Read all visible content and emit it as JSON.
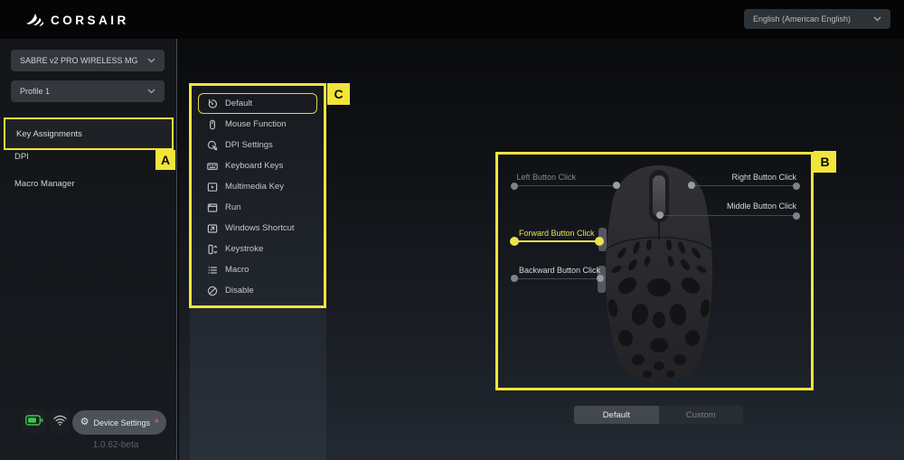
{
  "header": {
    "brand": "CORSAIR",
    "language_selector": {
      "value": "English (American English)"
    }
  },
  "sidebar": {
    "device_selector": {
      "value": "SABRE v2 PRO WIRELESS MG"
    },
    "profile_selector": {
      "value": "Profile 1"
    },
    "nav": [
      {
        "label": "Key Assignments",
        "active": true
      },
      {
        "label": "DPI",
        "active": false
      },
      {
        "label": "Macro Manager",
        "active": false
      }
    ],
    "status_bar": {
      "battery_icon": "battery-full-green",
      "wireless_icon": "wifi-signal",
      "device_settings_label": "Device Settings",
      "alert_glyph": "*",
      "version": "1.0.62-beta"
    }
  },
  "assignment_menu": {
    "items": [
      {
        "label": "Default",
        "icon": "reset-icon",
        "selected": true
      },
      {
        "label": "Mouse Function",
        "icon": "mouse-icon",
        "selected": false
      },
      {
        "label": "DPI Settings",
        "icon": "dpi-gauge-icon",
        "selected": false
      },
      {
        "label": "Keyboard Keys",
        "icon": "keyboard-icon",
        "selected": false
      },
      {
        "label": "Multimedia Key",
        "icon": "media-play-icon",
        "selected": false
      },
      {
        "label": "Run",
        "icon": "app-window-icon",
        "selected": false
      },
      {
        "label": "Windows Shortcut",
        "icon": "shortcut-arrow-icon",
        "selected": false
      },
      {
        "label": "Keystroke",
        "icon": "keystroke-icon",
        "selected": false
      },
      {
        "label": "Macro",
        "icon": "macro-list-icon",
        "selected": false
      },
      {
        "label": "Disable",
        "icon": "disable-icon",
        "selected": false
      }
    ]
  },
  "mouse_view": {
    "callouts": [
      {
        "label": "Left Button Click",
        "state": "dimmed"
      },
      {
        "label": "Right Button Click",
        "state": "normal"
      },
      {
        "label": "Middle Button Click",
        "state": "normal"
      },
      {
        "label": "Forward Button Click",
        "state": "selected"
      },
      {
        "label": "Backward Button Click",
        "state": "normal"
      }
    ],
    "mode_toggle": {
      "options": [
        {
          "label": "Default",
          "selected": true
        },
        {
          "label": "Custom",
          "selected": false
        }
      ]
    }
  },
  "annotations": {
    "a": "A",
    "b": "B",
    "c": "C"
  },
  "colors": {
    "annotation_yellow": "#f2e53a",
    "selected_yellow": "#e9e44c",
    "battery_green": "#3fc254",
    "alert_red": "#e25a50",
    "topbar_black": "#050505"
  }
}
